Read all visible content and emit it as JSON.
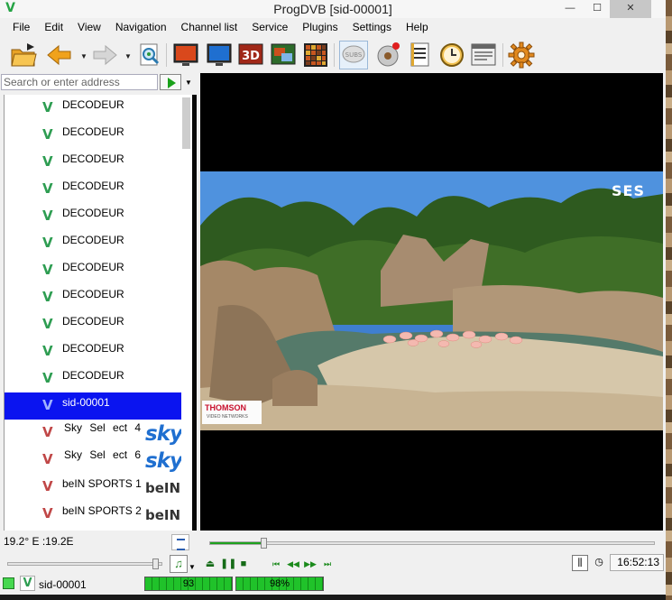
{
  "window": {
    "title": "ProgDVB [sid-00001]",
    "minimize": "—",
    "maximize": "☐",
    "close": "✕"
  },
  "menu": [
    "File",
    "Edit",
    "View",
    "Navigation",
    "Channel list",
    "Service",
    "Plugins",
    "Settings",
    "Help"
  ],
  "toolbar": {
    "icons": [
      "open-folder-icon",
      "back-arrow-icon",
      "forward-arrow-icon",
      "search-page-icon",
      "tv-screen-icon",
      "monitor-icon",
      "3d-icon",
      "picture-in-picture-icon",
      "mosaic-grid-icon",
      "subtitles-icon",
      "record-disc-icon",
      "epg-list-icon",
      "scheduler-clock-icon",
      "teletext-icon",
      "settings-gear-icon"
    ],
    "subs_label": "SUBS",
    "3d_label": "3D"
  },
  "search": {
    "placeholder": "Search or enter address",
    "value": ""
  },
  "channels": [
    {
      "name": "DECODEUR",
      "v_color": "#2e9d52",
      "selected": false
    },
    {
      "name": "DECODEUR",
      "v_color": "#2e9d52",
      "selected": false
    },
    {
      "name": "DECODEUR",
      "v_color": "#2e9d52",
      "selected": false
    },
    {
      "name": "DECODEUR",
      "v_color": "#2e9d52",
      "selected": false
    },
    {
      "name": "DECODEUR",
      "v_color": "#2e9d52",
      "selected": false
    },
    {
      "name": "DECODEUR",
      "v_color": "#2e9d52",
      "selected": false
    },
    {
      "name": "DECODEUR",
      "v_color": "#2e9d52",
      "selected": false
    },
    {
      "name": "DECODEUR",
      "v_color": "#2e9d52",
      "selected": false
    },
    {
      "name": "DECODEUR",
      "v_color": "#2e9d52",
      "selected": false
    },
    {
      "name": "DECODEUR",
      "v_color": "#2e9d52",
      "selected": false
    },
    {
      "name": "DECODEUR",
      "v_color": "#2e9d52",
      "selected": false
    },
    {
      "name": "sid-00001",
      "selected": true
    },
    {
      "name": "Sky Sel ect 4",
      "logo": "sky",
      "v_color": "#c04747",
      "selected": false
    },
    {
      "name": "Sky Sel ect 6",
      "logo": "sky",
      "v_color": "#c04747",
      "selected": false
    },
    {
      "name": "beIN SPORTS 1",
      "logo": "beIN",
      "v_color": "#c04747",
      "selected": false
    },
    {
      "name": "beIN SPORTS 2",
      "logo": "beIN",
      "v_color": "#c04747",
      "selected": false
    }
  ],
  "video": {
    "overlay_logo": "SES",
    "watermark_name": "THOMSON",
    "watermark_sub": "VIDEO NETWORKS"
  },
  "status": {
    "coords": "19.2° E :19.2E",
    "seek_progress": 0.12,
    "volume_level": 0.97,
    "clock": "16:52:13",
    "channel_name": "sid-00001",
    "signal_strength": "93",
    "signal_quality": "98%"
  },
  "player_controls": [
    "eject-icon",
    "pause-icon",
    "stop-icon",
    "skip-back-icon",
    "rewind-icon",
    "fast-forward-icon",
    "skip-forward-icon"
  ],
  "colors": {
    "selected_row": "#0a14f0",
    "accent_green": "#1ea21e"
  }
}
